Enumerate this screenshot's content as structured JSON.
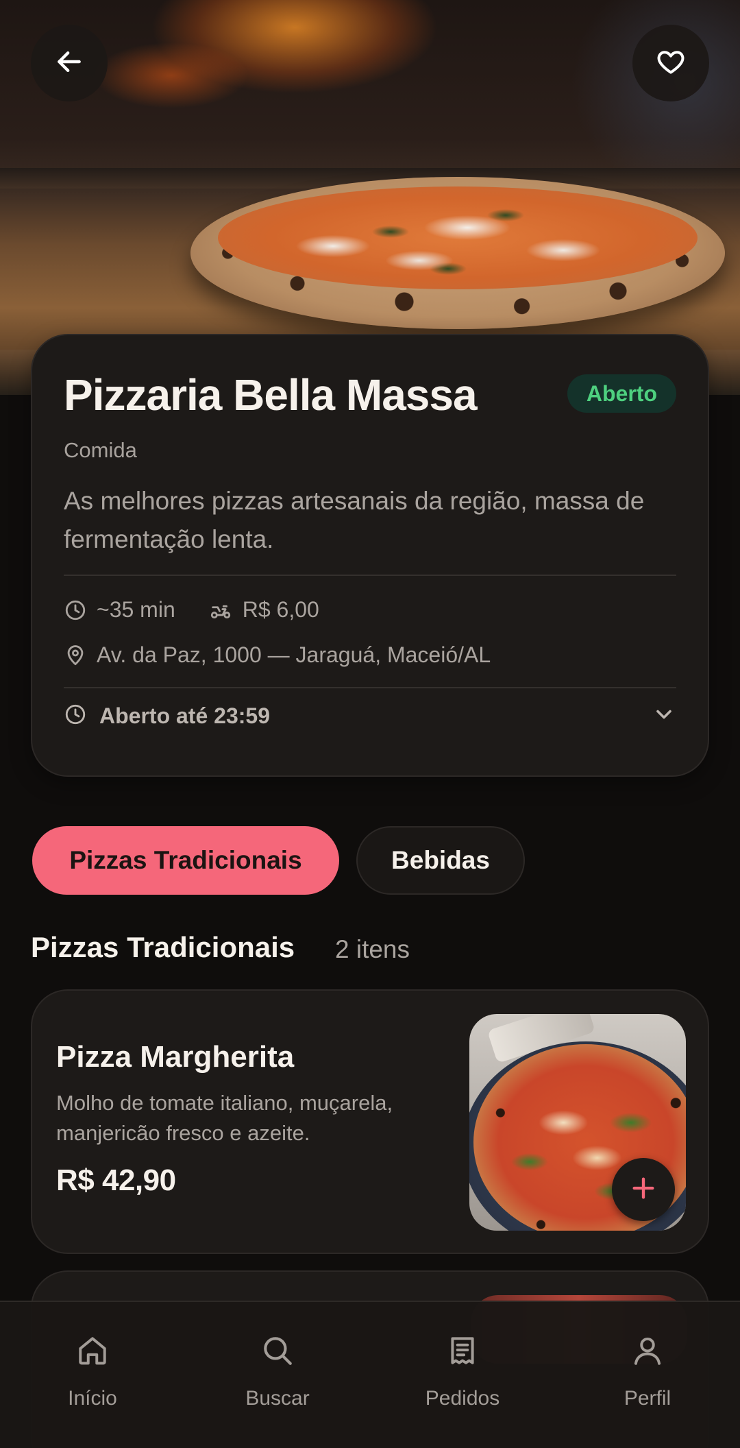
{
  "restaurant": {
    "name": "Pizzaria Bella Massa",
    "status": "Aberto",
    "category": "Comida",
    "description": "As melhores pizzas artesanais da região, massa de fermentação lenta.",
    "delivery_time": "~35 min",
    "delivery_fee": "R$ 6,00",
    "address": "Av. da Paz, 1000 — Jaraguá, Maceió/AL",
    "hours": "Aberto até 23:59"
  },
  "tabs": [
    {
      "label": "Pizzas Tradicionais",
      "active": true
    },
    {
      "label": "Bebidas",
      "active": false
    }
  ],
  "section": {
    "title": "Pizzas Tradicionais",
    "count": "2 itens"
  },
  "products": [
    {
      "name": "Pizza Margherita",
      "description": "Molho de tomate italiano, muçarela, manjericão fresco e azeite.",
      "price": "R$ 42,90"
    }
  ],
  "nav": [
    {
      "label": "Início",
      "icon": "home-icon"
    },
    {
      "label": "Buscar",
      "icon": "search-icon"
    },
    {
      "label": "Pedidos",
      "icon": "orders-icon"
    },
    {
      "label": "Perfil",
      "icon": "profile-icon"
    }
  ],
  "colors": {
    "accent": "#f5677a",
    "status_open": "#4ed07f",
    "background": "#0f0d0c",
    "card": "#1d1a18"
  }
}
